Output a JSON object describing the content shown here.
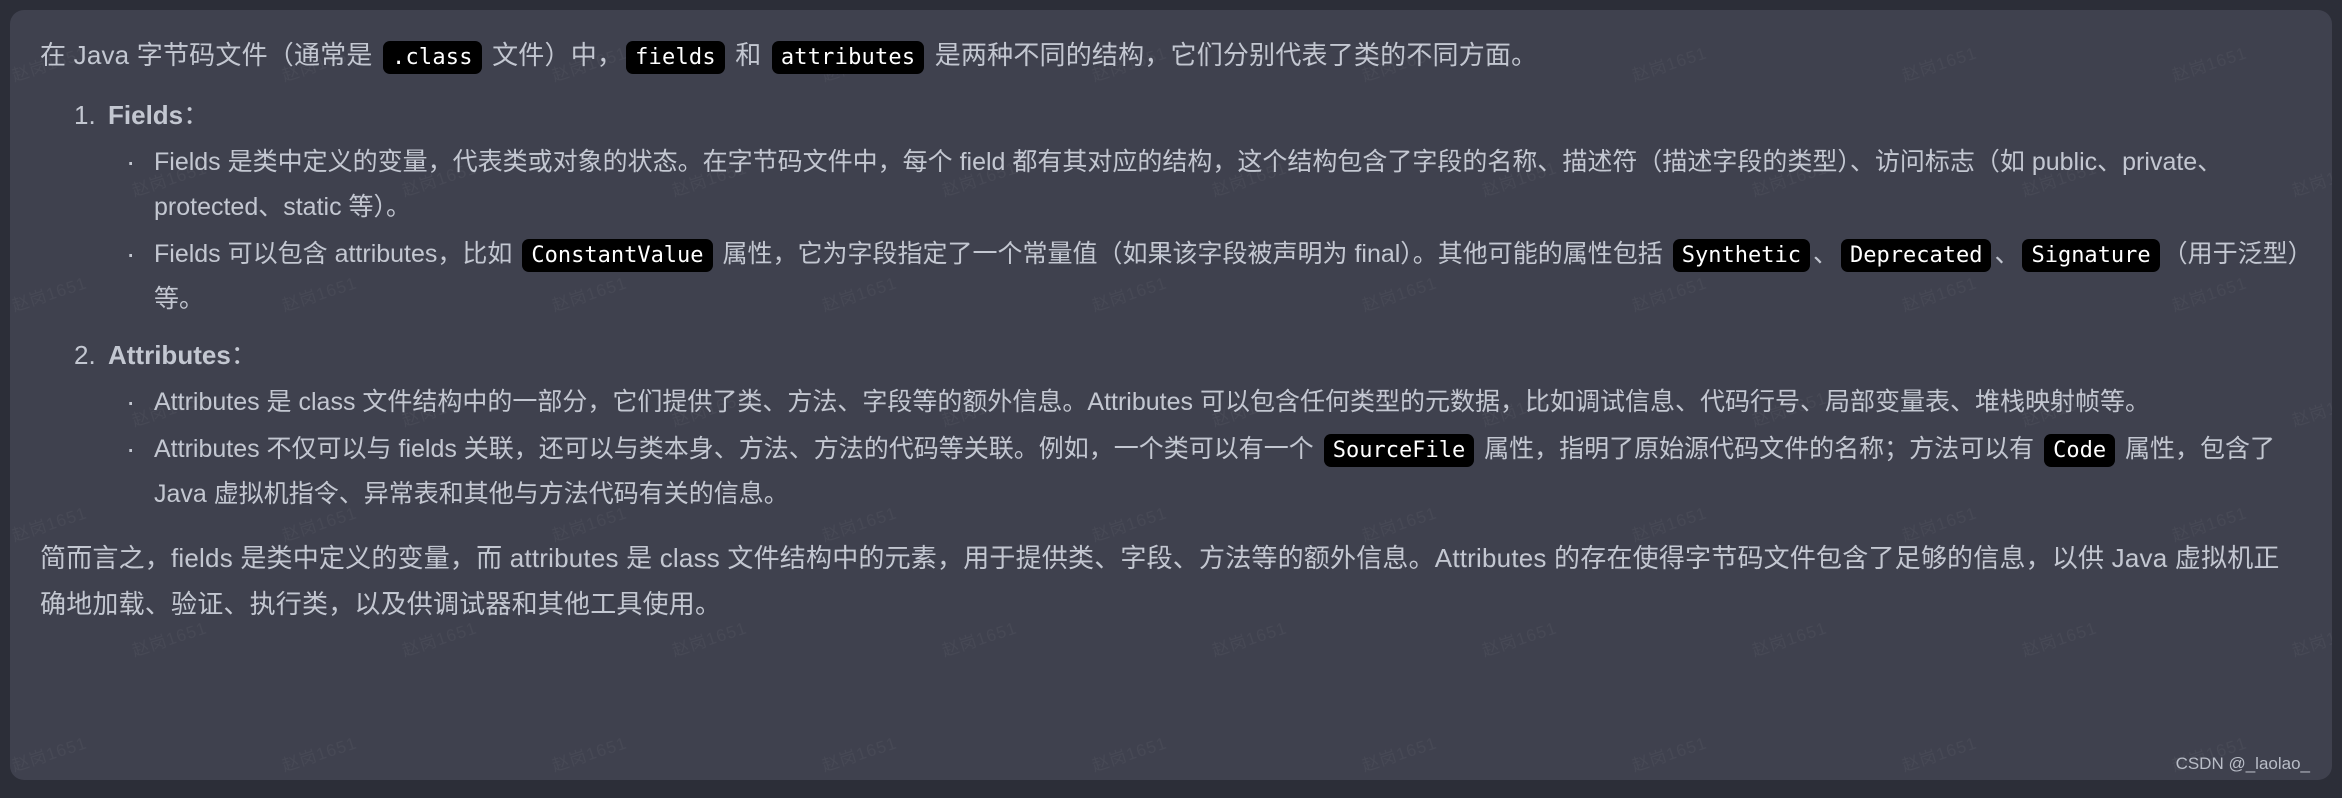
{
  "card": {
    "intro": {
      "seg1": "在 Java 字节码文件（通常是 ",
      "code1": ".class",
      "seg2": " 文件）中，",
      "code2": "fields",
      "seg3": " 和 ",
      "code3": "attributes",
      "seg4": " 是两种不同的结构，它们分别代表了类的不同方面。"
    },
    "sections": [
      {
        "heading": "Fields",
        "heading_suffix": "：",
        "bullets": [
          {
            "parts": [
              {
                "type": "text",
                "value": "Fields 是类中定义的变量，代表类或对象的状态。在字节码文件中，每个 field 都有其对应的结构，这个结构包含了字段的名称、描述符（描述字段的类型）、访问标志（如 public、private、protected、static 等）。"
              }
            ]
          },
          {
            "parts": [
              {
                "type": "text",
                "value": "Fields 可以包含 attributes，比如 "
              },
              {
                "type": "code",
                "value": "ConstantValue"
              },
              {
                "type": "text",
                "value": " 属性，它为字段指定了一个常量值（如果该字段被声明为 final）。其他可能的属性包括 "
              },
              {
                "type": "code",
                "value": "Synthetic"
              },
              {
                "type": "text",
                "value": "、"
              },
              {
                "type": "code",
                "value": "Deprecated"
              },
              {
                "type": "text",
                "value": "、"
              },
              {
                "type": "code",
                "value": "Signature"
              },
              {
                "type": "text",
                "value": "（用于泛型）等。"
              }
            ]
          }
        ]
      },
      {
        "heading": "Attributes",
        "heading_suffix": "：",
        "bullets": [
          {
            "parts": [
              {
                "type": "text",
                "value": "Attributes 是 class 文件结构中的一部分，它们提供了类、方法、字段等的额外信息。Attributes 可以包含任何类型的元数据，比如调试信息、代码行号、局部变量表、堆栈映射帧等。"
              }
            ]
          },
          {
            "parts": [
              {
                "type": "text",
                "value": "Attributes 不仅可以与 fields 关联，还可以与类本身、方法、方法的代码等关联。例如，一个类可以有一个 "
              },
              {
                "type": "code",
                "value": "SourceFile"
              },
              {
                "type": "text",
                "value": " 属性，指明了原始源代码文件的名称；方法可以有 "
              },
              {
                "type": "code",
                "value": "Code"
              },
              {
                "type": "text",
                "value": " 属性，包含了 Java 虚拟机指令、异常表和其他与方法代码有关的信息。"
              }
            ]
          }
        ]
      }
    ],
    "summary": "简而言之，fields 是类中定义的变量，而 attributes 是 class 文件结构中的元素，用于提供类、字段、方法等的额外信息。Attributes 的存在使得字节码文件包含了足够的信息，以供 Java 虚拟机正确地加载、验证、执行类，以及供调试器和其他工具使用。"
  },
  "watermark": {
    "text": "赵岗1651",
    "csdn": "CSDN @_laolao_"
  },
  "colors": {
    "page_background": "#2c2e38",
    "card_background": "#3f414e",
    "text": "#c3c7d1",
    "code_background": "#000000",
    "code_text": "#ffffff"
  }
}
